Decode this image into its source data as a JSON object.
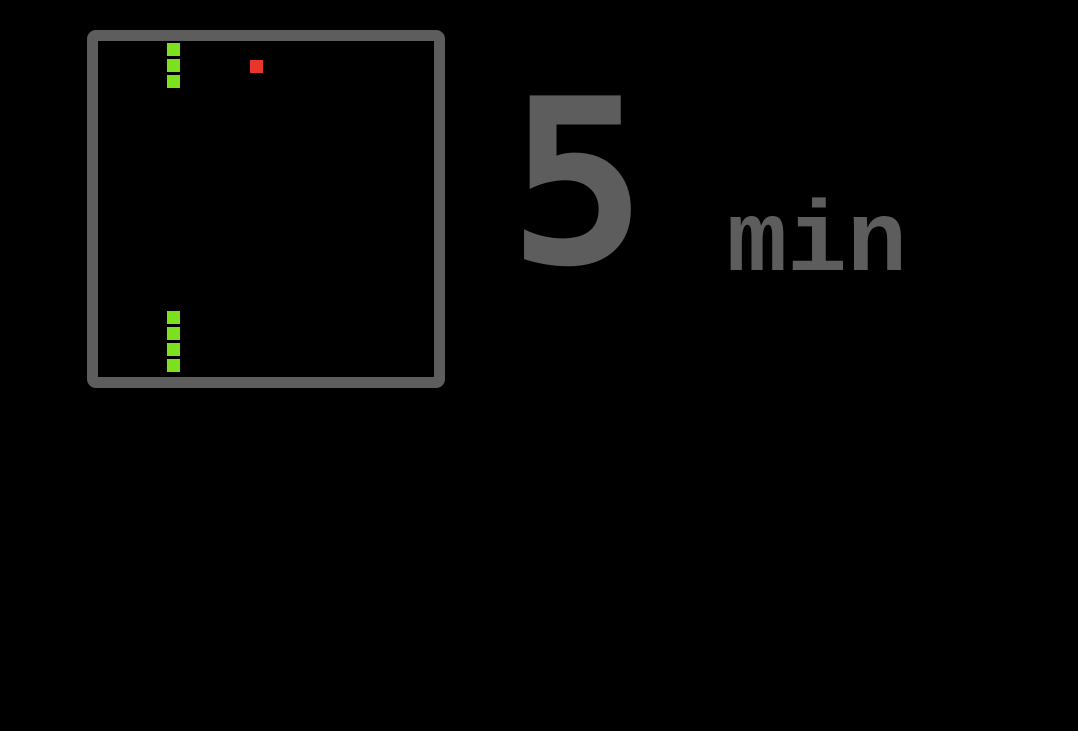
{
  "timer": {
    "value": "5",
    "unit": "min"
  },
  "colors": {
    "background": "#000000",
    "frame": "#5d5d5d",
    "snake": "#7de01f",
    "food": "#e8362b",
    "text": "#5d5d5d"
  }
}
